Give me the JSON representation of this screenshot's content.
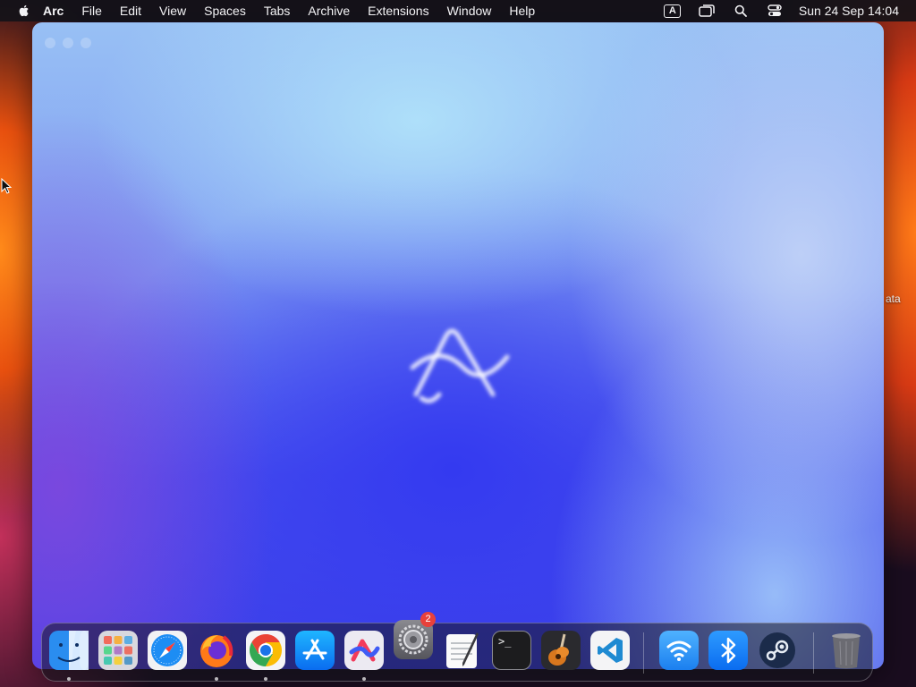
{
  "menubar": {
    "app_name": "Arc",
    "items": [
      "File",
      "Edit",
      "View",
      "Spaces",
      "Tabs",
      "Archive",
      "Extensions",
      "Window",
      "Help"
    ],
    "input_source": "A",
    "datetime": "Sun 24 Sep  14:04",
    "icons": [
      "apple-icon",
      "keyboard-input-icon",
      "screen-mirroring-icon",
      "search-icon",
      "control-center-icon"
    ]
  },
  "desktop": {
    "partial_label": "ata"
  },
  "window": {
    "app": "Arc",
    "logo": "arc-logo-icon"
  },
  "dock": {
    "apps": [
      {
        "name": "Finder",
        "icon": "finder-icon",
        "running": true
      },
      {
        "name": "Launchpad",
        "icon": "launchpad-icon",
        "running": false
      },
      {
        "name": "Safari",
        "icon": "safari-icon",
        "running": false
      },
      {
        "name": "Firefox",
        "icon": "firefox-icon",
        "running": true
      },
      {
        "name": "Google Chrome",
        "icon": "chrome-icon",
        "running": true
      },
      {
        "name": "App Store",
        "icon": "app-store-icon",
        "running": false
      },
      {
        "name": "Arc",
        "icon": "arc-icon",
        "running": true
      },
      {
        "name": "System Settings",
        "icon": "system-settings-icon",
        "running": false,
        "badge": "2"
      },
      {
        "name": "TextEdit",
        "icon": "textedit-icon",
        "running": false
      },
      {
        "name": "Terminal",
        "icon": "terminal-icon",
        "running": false,
        "glyph": ">_"
      },
      {
        "name": "GarageBand",
        "icon": "garageband-icon",
        "running": false
      },
      {
        "name": "Visual Studio Code",
        "icon": "vscode-icon",
        "running": false
      },
      {
        "name": "Wireless Diagnostics",
        "icon": "wifi-icon",
        "running": false
      },
      {
        "name": "Bluetooth File Exchange",
        "icon": "bluetooth-icon",
        "running": false
      },
      {
        "name": "Steam",
        "icon": "steam-icon",
        "running": false
      },
      {
        "name": "Trash",
        "icon": "trash-icon",
        "running": false
      }
    ]
  }
}
